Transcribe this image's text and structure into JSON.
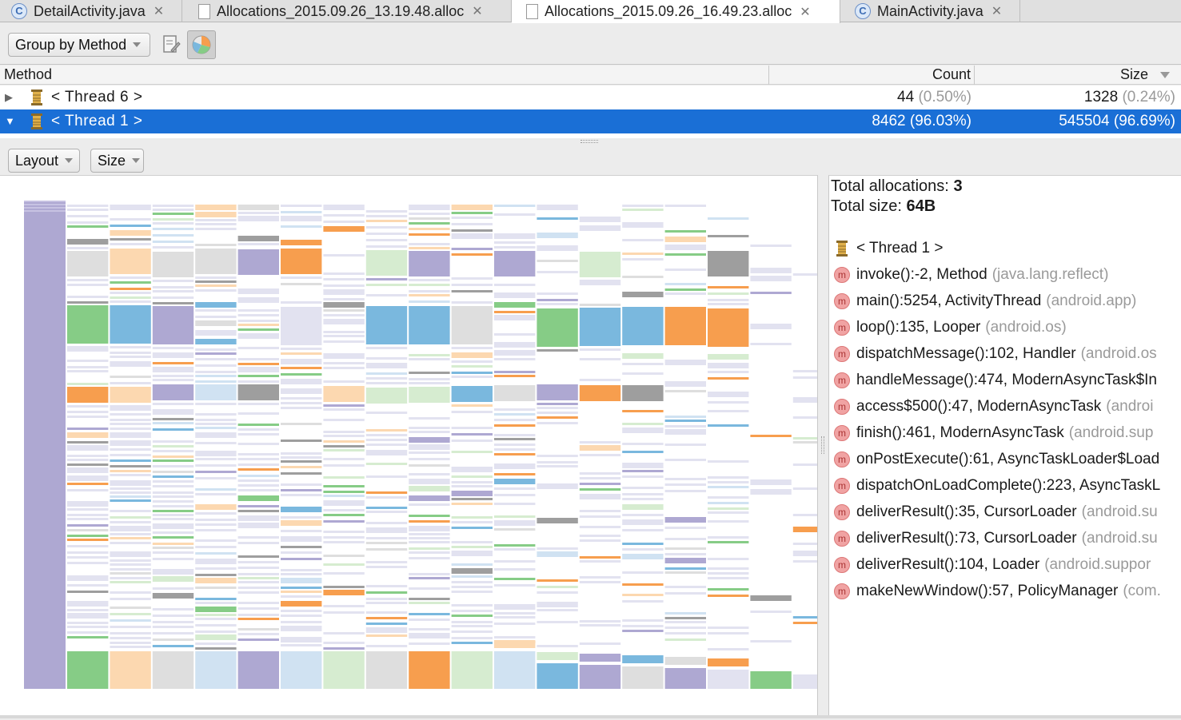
{
  "tabs": [
    {
      "label": "DetailActivity.java",
      "icon": "java-class-icon",
      "active": false
    },
    {
      "label": "Allocations_2015.09.26_13.19.48.alloc",
      "icon": "file-icon",
      "active": false
    },
    {
      "label": "Allocations_2015.09.26_16.49.23.alloc",
      "icon": "file-icon",
      "active": true
    },
    {
      "label": "MainActivity.java",
      "icon": "java-class-icon",
      "active": false
    }
  ],
  "toolbar": {
    "group_by": "Group by Method",
    "icons": [
      "export-icon",
      "chart-toggle-icon"
    ]
  },
  "table": {
    "columns": {
      "method": "Method",
      "count": "Count",
      "size": "Size"
    },
    "rows": [
      {
        "name": "< Thread 6 >",
        "count": "44",
        "count_pct": "(0.50%)",
        "size": "1328",
        "size_pct": "(0.24%)",
        "expanded": false,
        "selected": false
      },
      {
        "name": "< Thread 1 >",
        "count": "8462",
        "count_pct": "(96.03%)",
        "size": "545504",
        "size_pct": "(96.69%)",
        "expanded": true,
        "selected": true
      }
    ]
  },
  "chart_toolbar": {
    "layout": "Layout",
    "size": "Size"
  },
  "info": {
    "total_allocations_label": "Total allocations:",
    "total_allocations_value": "3",
    "total_size_label": "Total size:",
    "total_size_value": "64B",
    "thread": "< Thread 1 >",
    "frames": [
      {
        "method": "invoke():-2, Method",
        "pkg": "(java.lang.reflect)"
      },
      {
        "method": "main():5254, ActivityThread",
        "pkg": "(android.app)"
      },
      {
        "method": "loop():135, Looper",
        "pkg": "(android.os)"
      },
      {
        "method": "dispatchMessage():102, Handler",
        "pkg": "(android.os"
      },
      {
        "method": "handleMessage():474, ModernAsyncTask$In",
        "pkg": ""
      },
      {
        "method": "access$500():47, ModernAsyncTask",
        "pkg": "(androi"
      },
      {
        "method": "finish():461, ModernAsyncTask",
        "pkg": "(android.sup"
      },
      {
        "method": "onPostExecute():61, AsyncTaskLoader$Load",
        "pkg": ""
      },
      {
        "method": "dispatchOnLoadComplete():223, AsyncTaskL",
        "pkg": ""
      },
      {
        "method": "deliverResult():35, CursorLoader",
        "pkg": "(android.su"
      },
      {
        "method": "deliverResult():73, CursorLoader",
        "pkg": "(android.su"
      },
      {
        "method": "deliverResult():104, Loader",
        "pkg": "(android.suppor"
      },
      {
        "method": "makeNewWindow():57, PolicyManager",
        "pkg": "(com."
      }
    ]
  },
  "palette": [
    "#e2e2f0",
    "#9e9e9e",
    "#7ab8de",
    "#f79e4e",
    "#86cc86",
    "#d6ecd0",
    "#fcd8b0",
    "#d0e2f2",
    "#aea8d2",
    "#dedede"
  ],
  "chart_root_color": "#aea8d2"
}
